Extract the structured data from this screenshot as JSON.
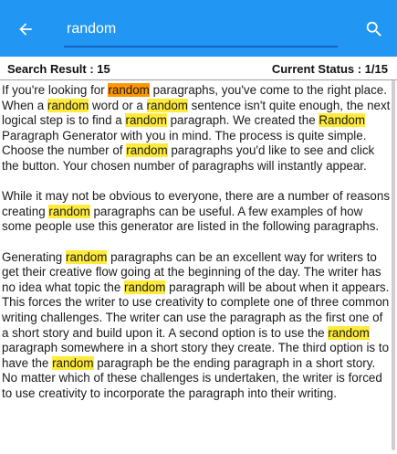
{
  "appbar": {
    "search_value": "random",
    "back_icon": "arrow-left-icon",
    "search_icon": "search-icon",
    "bg_color": "#2196f3"
  },
  "status": {
    "result_label": "Search Result : 15",
    "current_label": "Current Status : 1/15"
  },
  "highlight": {
    "match_color": "#ffeb3b",
    "current_color": "#ff9800"
  },
  "paragraphs": [
    [
      {
        "t": "If you're looking for "
      },
      {
        "t": "random",
        "h": "current"
      },
      {
        "t": " paragraphs, you've come to the right place. When a "
      },
      {
        "t": "random",
        "h": "match"
      },
      {
        "t": " word or a "
      },
      {
        "t": "random",
        "h": "match"
      },
      {
        "t": " sentence isn't quite enough, the next logical step is to find a "
      },
      {
        "t": "random",
        "h": "match"
      },
      {
        "t": " paragraph. We created the "
      },
      {
        "t": "Random",
        "h": "match"
      },
      {
        "t": " Paragraph Generator with you in mind. The process is quite simple. Choose the number of "
      },
      {
        "t": "random",
        "h": "match"
      },
      {
        "t": " paragraphs you'd like to see and click the button. Your chosen number of paragraphs will instantly appear."
      }
    ],
    [
      {
        "t": "While it may not be obvious to everyone, there are a number of reasons creating "
      },
      {
        "t": "random",
        "h": "match"
      },
      {
        "t": " paragraphs can be useful. A few examples of how some people use this generator are listed in the following paragraphs."
      }
    ],
    [
      {
        "t": "Generating "
      },
      {
        "t": "random",
        "h": "match"
      },
      {
        "t": " paragraphs can be an excellent way for writers to get their creative flow going at the beginning of the day. The writer has no idea what topic the "
      },
      {
        "t": "random",
        "h": "match"
      },
      {
        "t": " paragraph will be about when it appears. This forces the writer to use creativity to complete one of three common writing challenges. The writer can use the paragraph as the first one of a short story and build upon it. A second option is to use the "
      },
      {
        "t": "random",
        "h": "match"
      },
      {
        "t": " paragraph somewhere in a short story they create. The third option is to have the "
      },
      {
        "t": "random",
        "h": "match"
      },
      {
        "t": " paragraph be the ending paragraph in a short story. No matter which of these challenges is undertaken, the writer is forced to use creativity to incorporate the paragraph into their writing."
      }
    ]
  ]
}
